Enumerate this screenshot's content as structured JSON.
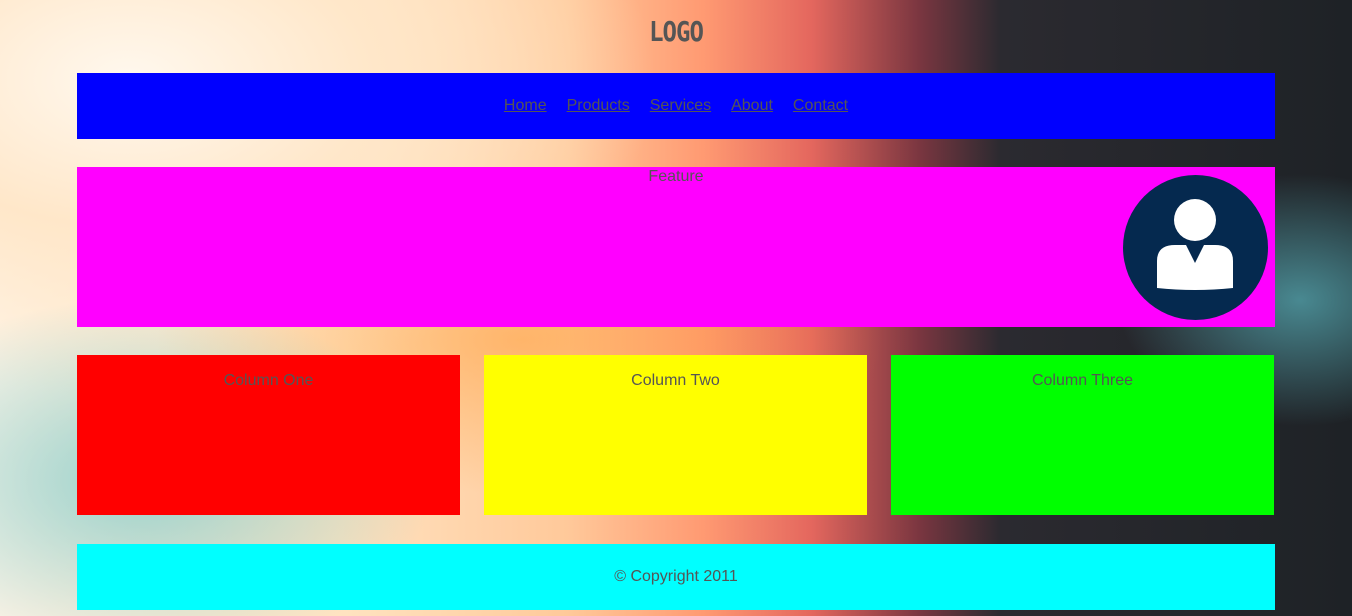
{
  "header": {
    "logo": "LOGO"
  },
  "nav": {
    "items": [
      "Home",
      "Products",
      "Services",
      "About",
      "Contact"
    ]
  },
  "feature": {
    "title": "Feature"
  },
  "columns": [
    "Column One",
    "Column Two",
    "Column Three"
  ],
  "footer": {
    "text": "© Copyright 2011"
  },
  "colors": {
    "nav": "#0000ff",
    "feature": "#ff00ff",
    "column_one": "#ff0000",
    "column_two": "#ffff00",
    "column_three": "#00ff00",
    "footer": "#00ffff",
    "avatar": "#05294f",
    "text": "#555555"
  }
}
